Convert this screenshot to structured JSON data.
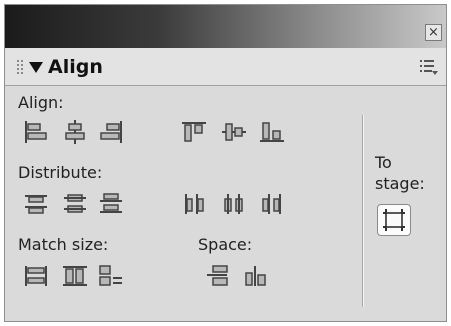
{
  "panel": {
    "close_glyph": "×",
    "title": "Align",
    "menu_icon": "options-menu-icon"
  },
  "sections": {
    "align": "Align:",
    "distribute": "Distribute:",
    "match_size": "Match size:",
    "space": "Space:",
    "to_stage_line1": "To",
    "to_stage_line2": "stage:"
  },
  "colors": {
    "icon_dark": "#444444",
    "icon_fill": "#b8b8b8",
    "panel_bg": "#dadada"
  }
}
